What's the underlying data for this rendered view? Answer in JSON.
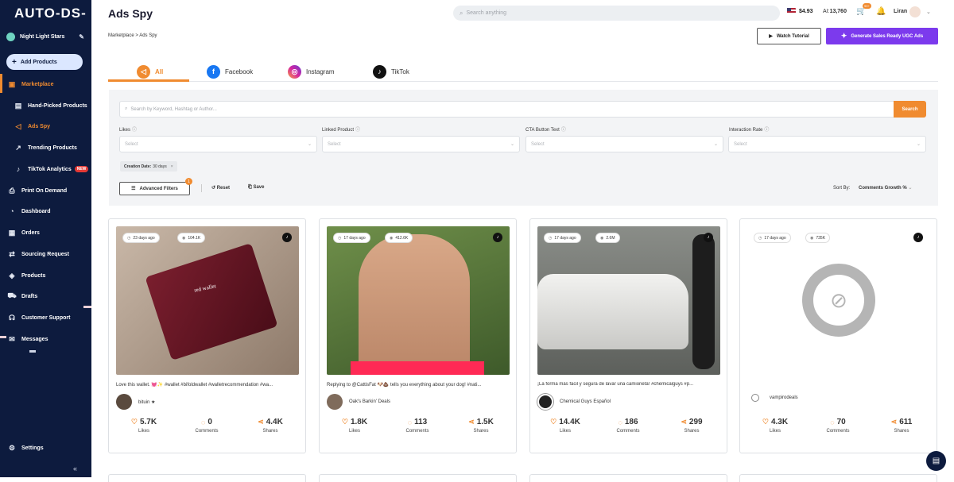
{
  "sidebar": {
    "logo": "AUTO-DS-",
    "store_name": "Night Light Stars",
    "add_products": "Add Products",
    "items": [
      {
        "label": "Marketplace",
        "icon": "store-icon"
      },
      {
        "label": "Hand-Picked Products",
        "icon": "box-icon"
      },
      {
        "label": "Ads Spy",
        "icon": "megaphone-icon"
      },
      {
        "label": "Trending Products",
        "icon": "trend-icon"
      },
      {
        "label": "TikTok Analytics",
        "icon": "tiktok-icon",
        "badge": "NEW"
      },
      {
        "label": "Print On Demand",
        "icon": "print-icon"
      },
      {
        "label": "Dashboard",
        "icon": "gauge-icon"
      },
      {
        "label": "Orders",
        "icon": "orders-icon"
      },
      {
        "label": "Sourcing Request",
        "icon": "sourcing-icon"
      },
      {
        "label": "Products",
        "icon": "products-icon"
      },
      {
        "label": "Drafts",
        "icon": "drafts-icon"
      },
      {
        "label": "Customer Support",
        "icon": "support-icon"
      },
      {
        "label": "Messages",
        "icon": "mail-icon"
      },
      {
        "label": "Settings",
        "icon": "gear-icon"
      }
    ]
  },
  "header": {
    "title": "Ads Spy",
    "search_placeholder": "Search anything",
    "balance": "$4.93",
    "ai_label": "AI:",
    "ai_value": "13,760",
    "cart_badge": "99+",
    "user": "Liran"
  },
  "breadcrumb": "Marketplace > Ads Spy",
  "actions": {
    "watch": "Watch Tutorial",
    "ugc": "Generate Sales Ready UGC Ads"
  },
  "tabs": [
    "All",
    "Facebook",
    "Instagram",
    "TikTok"
  ],
  "filters": {
    "search_placeholder": "Search by Keyword, Hashtag or Author...",
    "search_button": "Search",
    "labels": [
      "Likes",
      "Linked Product",
      "CTA Button Text",
      "Interaction Rate"
    ],
    "select_placeholder": "Select",
    "chip_key": "Creation Date:",
    "chip_value": "30 days",
    "advanced": "Advanced Filters",
    "advanced_count": "1",
    "reset": "Reset",
    "save": "Save",
    "sort_label": "Sort By:",
    "sort_value": "Comments Growth %"
  },
  "cards": [
    {
      "age": "23 days ago",
      "views": "104.1K",
      "caption": "Love this wallet. 💓✨ #wallet #bifoldwallet #walletrecommendation #wa...",
      "author": "bituin ★",
      "likes": "5.7K",
      "comments": "0",
      "shares": "4.4K",
      "image_text": "red wallet"
    },
    {
      "age": "17 days ago",
      "views": "412.6K",
      "caption": "Replying to @CattisFat 🐶💩 tells you everything about your dog! #nati...",
      "author": "Oak's Barkin' Deals",
      "likes": "1.8K",
      "comments": "113",
      "shares": "1.5K"
    },
    {
      "age": "17 days ago",
      "views": "2.6M",
      "caption": "¡La forma más fácil y segura de lavar una camioneta! #chemicalguys #p...",
      "author": "Chemical Guys Español",
      "likes": "14.4K",
      "comments": "186",
      "shares": "299"
    },
    {
      "age": "17 days ago",
      "views": "735K",
      "caption": "",
      "author": "vampirodeals",
      "likes": "4.3K",
      "comments": "70",
      "shares": "611"
    }
  ],
  "stat_labels": {
    "likes": "Likes",
    "comments": "Comments",
    "shares": "Shares"
  },
  "colors": {
    "accent": "#f08b30",
    "sidebar": "#0d1b3e",
    "purple": "#7c3aed"
  }
}
